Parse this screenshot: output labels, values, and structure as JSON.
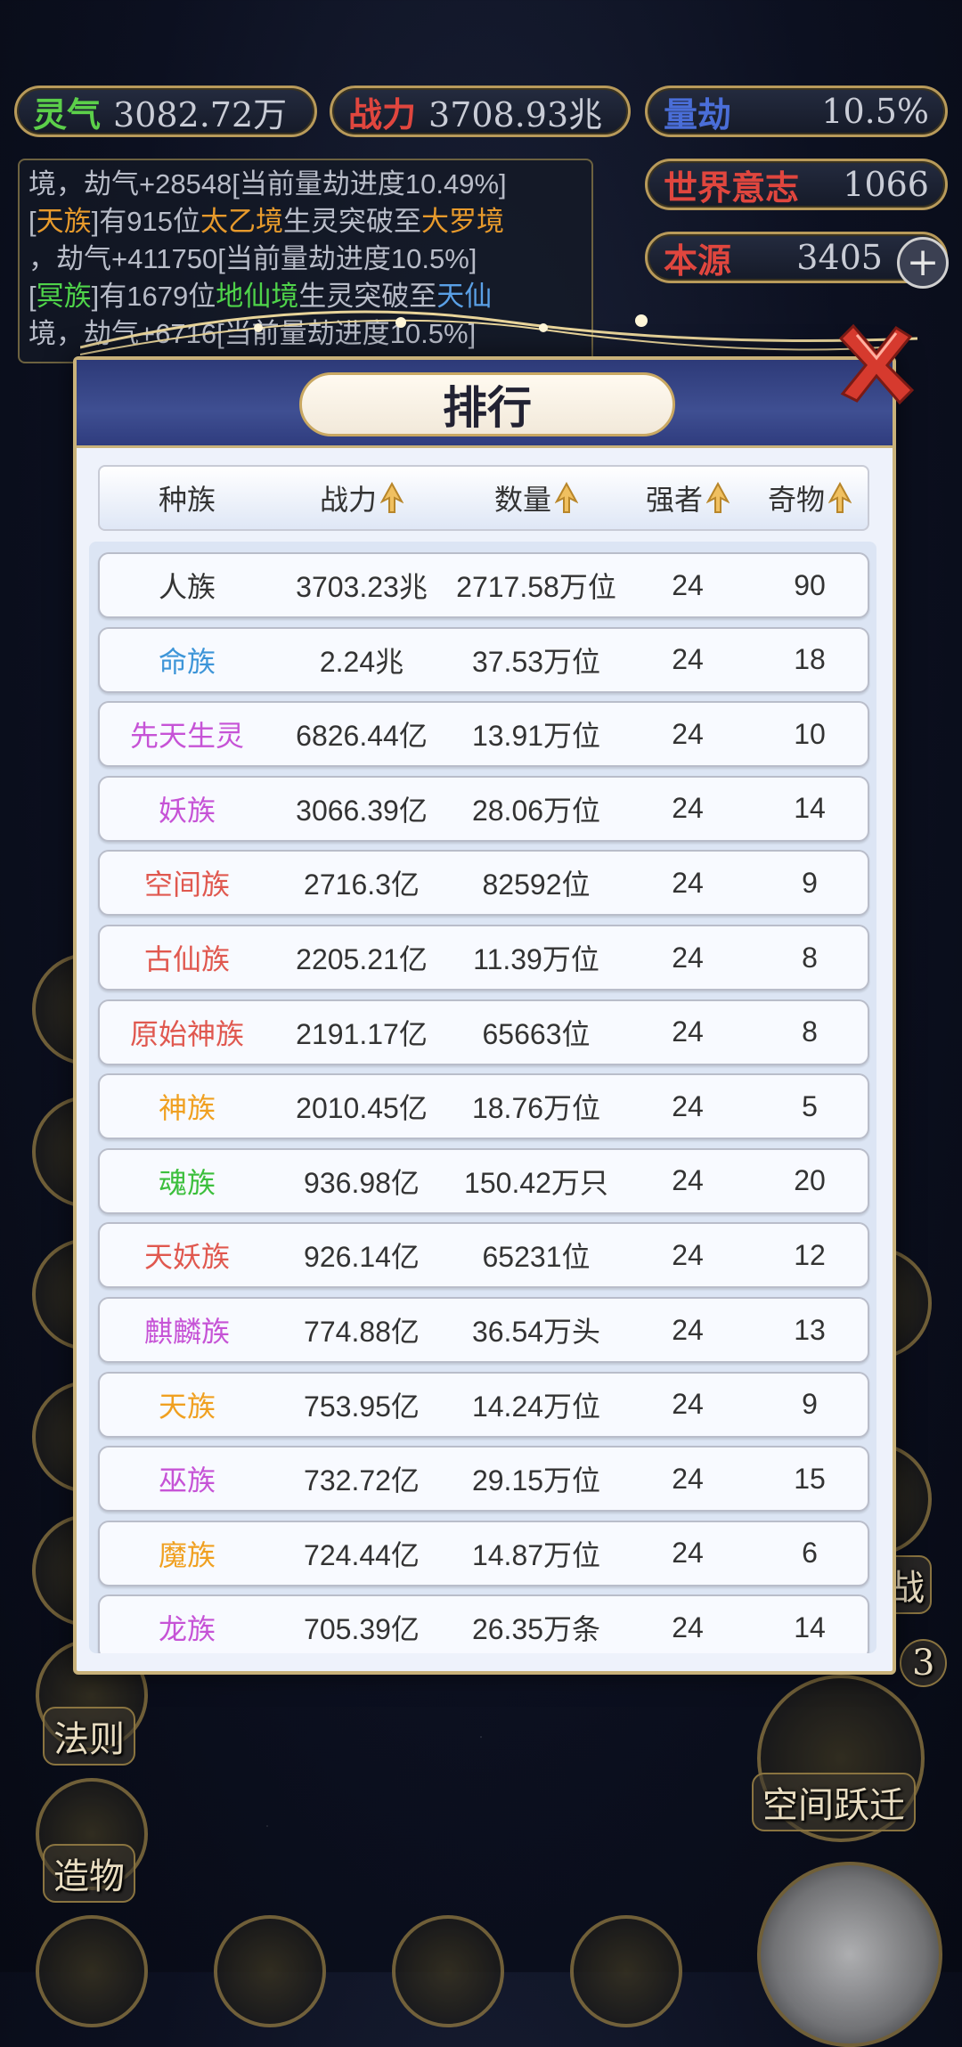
{
  "top_stats": {
    "lingqi": {
      "label": "灵气",
      "value": "3082.72万"
    },
    "zhanli": {
      "label": "战力",
      "value": "3708.93兆"
    },
    "liangjie": {
      "label": "量劫",
      "value": "10.5%"
    },
    "world_will": {
      "label": "世界意志",
      "value": "1066"
    },
    "benyuan": {
      "label": "本源",
      "value": "3405",
      "plus": "+"
    }
  },
  "log": {
    "line1": "境，劫气+28548[当前量劫进度10.49%]",
    "line2a": "[",
    "line2b": "天族",
    "line2c": "]有915位",
    "line2d": "太乙境",
    "line2e": "生灵突破至",
    "line2f": "大罗境",
    "line3": "，劫气+411750[当前量劫进度10.5%]",
    "line4a": "[",
    "line4b": "冥族",
    "line4c": "]有1679位",
    "line4d": "地仙境",
    "line4e": "生灵突破至",
    "line4f": "天仙",
    "line5": "境，劫气+6716[当前量劫进度10.5%]"
  },
  "side_labels": {
    "fa_ze": "法则",
    "zao_wu": "造物",
    "space_jump": "空间跃迁",
    "zhan": "战",
    "badge": "3"
  },
  "modal": {
    "title": "排行",
    "headers": {
      "race": "种族",
      "power": "战力",
      "count": "数量",
      "strong": "强者",
      "artifact": "奇物"
    },
    "rows": [
      {
        "race": "人族",
        "color": "#333333",
        "power": "3703.23兆",
        "count": "2717.58万位",
        "strong": "24",
        "artifact": "90"
      },
      {
        "race": "命族",
        "color": "#3d95d8",
        "power": "2.24兆",
        "count": "37.53万位",
        "strong": "24",
        "artifact": "18"
      },
      {
        "race": "先天生灵",
        "color": "#c653d6",
        "power": "6826.44亿",
        "count": "13.91万位",
        "strong": "24",
        "artifact": "10"
      },
      {
        "race": "妖族",
        "color": "#c653d6",
        "power": "3066.39亿",
        "count": "28.06万位",
        "strong": "24",
        "artifact": "14"
      },
      {
        "race": "空间族",
        "color": "#e0584f",
        "power": "2716.3亿",
        "count": "82592位",
        "strong": "24",
        "artifact": "9"
      },
      {
        "race": "古仙族",
        "color": "#e0584f",
        "power": "2205.21亿",
        "count": "11.39万位",
        "strong": "24",
        "artifact": "8"
      },
      {
        "race": "原始神族",
        "color": "#e0584f",
        "power": "2191.17亿",
        "count": "65663位",
        "strong": "24",
        "artifact": "8"
      },
      {
        "race": "神族",
        "color": "#f0a020",
        "power": "2010.45亿",
        "count": "18.76万位",
        "strong": "24",
        "artifact": "5"
      },
      {
        "race": "魂族",
        "color": "#3cbf3c",
        "power": "936.98亿",
        "count": "150.42万只",
        "strong": "24",
        "artifact": "20"
      },
      {
        "race": "天妖族",
        "color": "#e0584f",
        "power": "926.14亿",
        "count": "65231位",
        "strong": "24",
        "artifact": "12"
      },
      {
        "race": "麒麟族",
        "color": "#c653d6",
        "power": "774.88亿",
        "count": "36.54万头",
        "strong": "24",
        "artifact": "13"
      },
      {
        "race": "天族",
        "color": "#f0a020",
        "power": "753.95亿",
        "count": "14.24万位",
        "strong": "24",
        "artifact": "9"
      },
      {
        "race": "巫族",
        "color": "#c653d6",
        "power": "732.72亿",
        "count": "29.15万位",
        "strong": "24",
        "artifact": "15"
      },
      {
        "race": "魔族",
        "color": "#f0a020",
        "power": "724.44亿",
        "count": "14.87万位",
        "strong": "24",
        "artifact": "6"
      },
      {
        "race": "龙族",
        "color": "#c653d6",
        "power": "705.39亿",
        "count": "26.35万条",
        "strong": "24",
        "artifact": "14"
      }
    ]
  }
}
